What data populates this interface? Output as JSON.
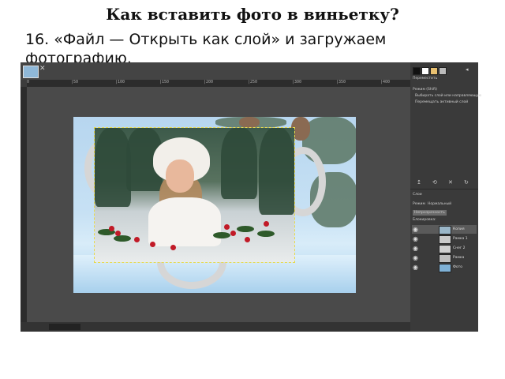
{
  "slide": {
    "title": "Как вставить фото в виньетку?",
    "text": "16. «Файл — Открыть как слой» и загружаем фотографию."
  },
  "editor": {
    "ruler_ticks": [
      "0",
      "|50",
      "|100",
      "|150",
      "|200",
      "|250",
      "|300",
      "|350",
      "|400",
      "|450"
    ],
    "panel": {
      "paths_label": "Переместить",
      "tool_label": "Режим (Shift)",
      "option1": "Выбирать слой или направляющую",
      "option2": "Перемещать активный слой",
      "layers_tab": "Слои",
      "mode_label": "Режим",
      "mode_value": "Нормальный",
      "opacity_label": "Непрозрачность",
      "lock_label": "Блокировка:",
      "layers": [
        {
          "name": "Копия",
          "color": "#9ab6c8"
        },
        {
          "name": "Рамка 1",
          "color": "#c9c9c9"
        },
        {
          "name": "Снег 2",
          "color": "#cfcfcf"
        },
        {
          "name": "Рамка",
          "color": "#bdbdbd"
        },
        {
          "name": "Фото",
          "color": "#7fb1d6"
        }
      ]
    },
    "colors": {
      "canvas_bg": "#4a4a4a",
      "selection": "#e8d94a"
    }
  }
}
